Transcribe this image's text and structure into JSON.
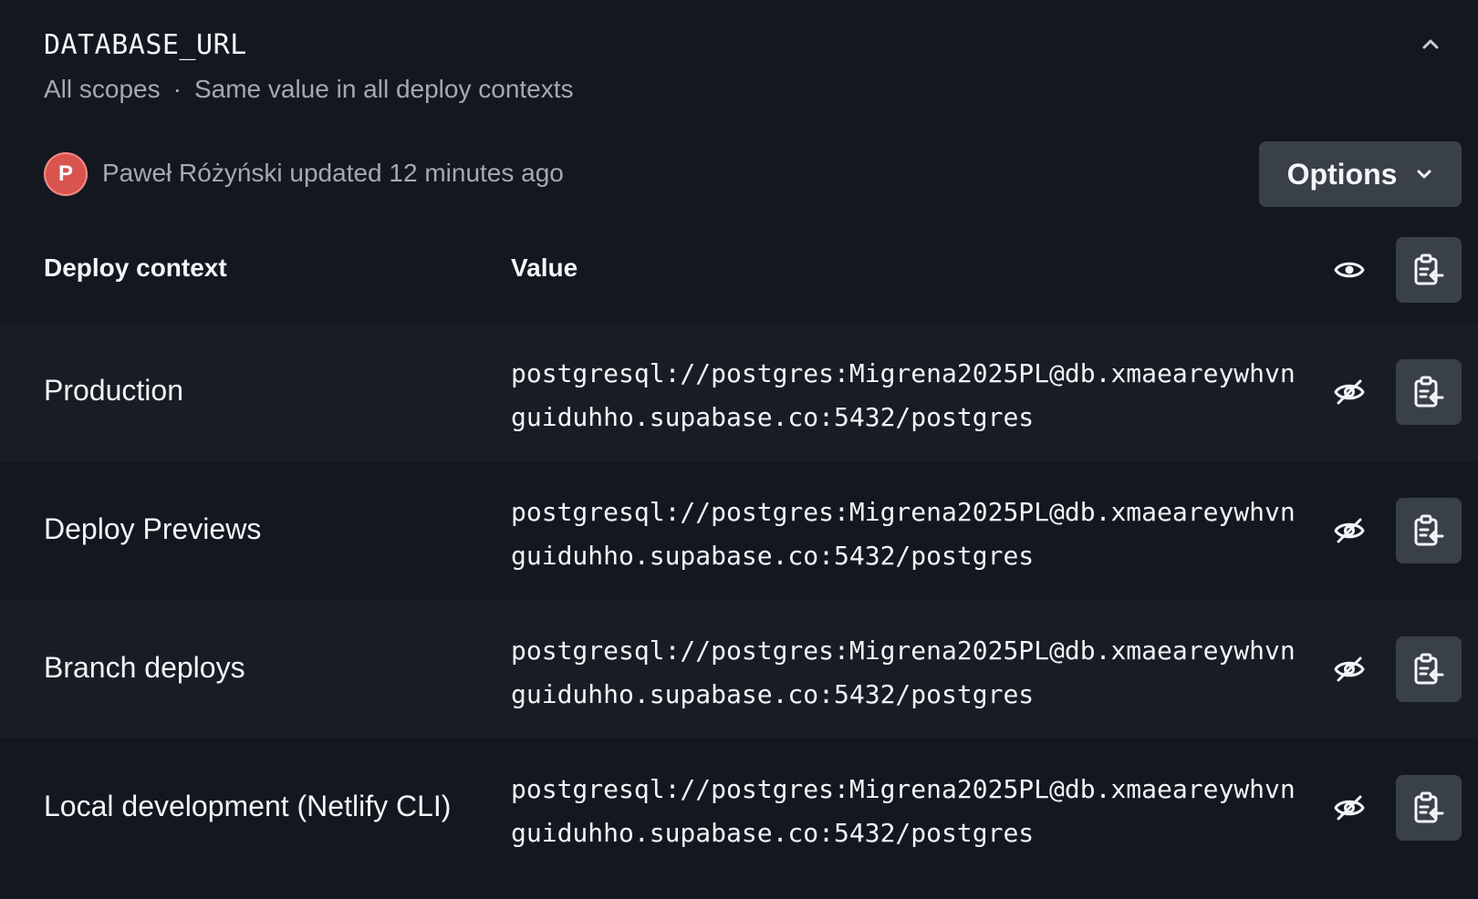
{
  "variable": {
    "name": "DATABASE_URL",
    "scopes": "All scopes",
    "separator": "·",
    "contexts_note": "Same value in all deploy contexts"
  },
  "updated": {
    "avatar_initial": "P",
    "text": "Paweł Różyński updated 12 minutes ago"
  },
  "options_button": {
    "label": "Options"
  },
  "table": {
    "headers": {
      "context": "Deploy context",
      "value": "Value"
    },
    "rows": [
      {
        "context": "Production",
        "value_line1": "postgresql://postgres:Migrena2025PL@db.xmaeareywhvn",
        "value_line2": "guiduhho.supabase.co:5432/postgres"
      },
      {
        "context": "Deploy Previews",
        "value_line1": "postgresql://postgres:Migrena2025PL@db.xmaeareywhvn",
        "value_line2": "guiduhho.supabase.co:5432/postgres"
      },
      {
        "context": "Branch deploys",
        "value_line1": "postgresql://postgres:Migrena2025PL@db.xmaeareywhvn",
        "value_line2": "guiduhho.supabase.co:5432/postgres"
      },
      {
        "context": "Local development (Netlify CLI)",
        "value_line1": "postgresql://postgres:Migrena2025PL@db.xmaeareywhvn",
        "value_line2": "guiduhho.supabase.co:5432/postgres"
      }
    ]
  },
  "icons": {
    "collapse": "chevron-up-icon",
    "options_dropdown": "chevron-down-icon",
    "show_all": "eye-icon",
    "hide": "eye-slash-icon",
    "copy": "clipboard-copy-icon"
  },
  "colors": {
    "background": "#131820",
    "row_alt": "#181d25",
    "button": "#3a4049",
    "avatar": "#d9534f",
    "muted_text": "#a3a9b4"
  }
}
